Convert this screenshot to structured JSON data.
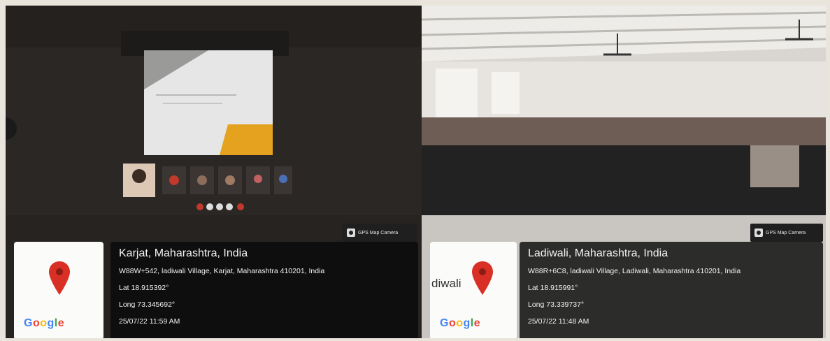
{
  "left_card": {
    "badge_label": "GPS Map Camera",
    "map_brand": "Google",
    "title": "Karjat, Maharashtra, India",
    "address": "W88W+542, ladiwali Village, Karjat, Maharashtra 410201, India",
    "latitude": "Lat 18.915392°",
    "longitude": "Long 73.345692°",
    "timestamp": "25/07/22 11:59 AM"
  },
  "right_card": {
    "badge_label": "GPS Map Camera",
    "map_brand": "Google",
    "map_place_label": "diwali",
    "title": "Ladiwali, Maharashtra, India",
    "address": "W88R+6C8, ladiwali Village, Ladiwali, Maharashtra 410201, India",
    "latitude": "Lat 18.915991°",
    "longitude": "Long 73.339737°",
    "timestamp": "25/07/22 11:48 AM"
  },
  "colors": {
    "pin": "#d93025",
    "overlay": "#0a0a0a"
  }
}
